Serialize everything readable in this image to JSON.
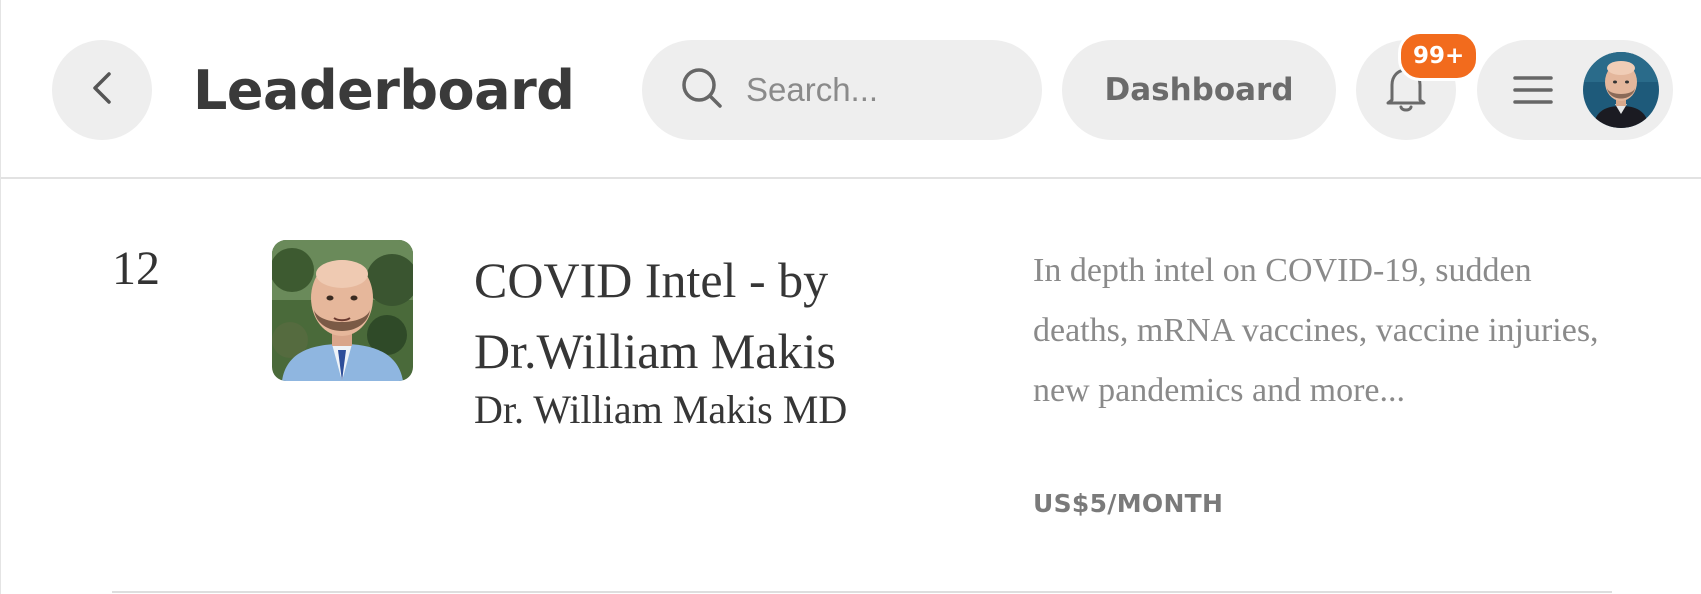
{
  "header": {
    "title": "Leaderboard",
    "search_placeholder": "Search...",
    "dashboard_label": "Dashboard",
    "notification_count": "99+",
    "icons": {
      "back": "chevron-left-icon",
      "search": "search-icon",
      "notifications": "bell-icon",
      "menu": "hamburger-menu-icon"
    }
  },
  "leaderboard": {
    "entries": [
      {
        "rank": "12",
        "title": "COVID Intel - by Dr.William Makis",
        "author": "Dr. William Makis MD",
        "description": "In depth intel on COVID-19, sudden deaths, mRNA vaccines, vaccine injuries, new pandemics and more...",
        "price": "US$5/MONTH"
      }
    ]
  },
  "colors": {
    "badge": "#f26b1d",
    "button_bg": "#eeeeee",
    "description_text": "#8a8a8a"
  }
}
